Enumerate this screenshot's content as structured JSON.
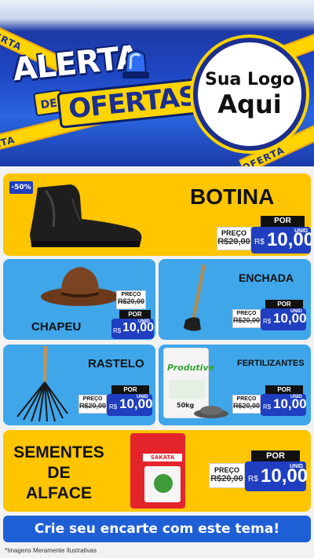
{
  "header": {
    "tape_text": "OFERTA",
    "tape_text_2": "ALERTA",
    "alerta": "ALERTA",
    "de": "DE",
    "ofertas": "OFERTAS",
    "logo_line1": "Sua Logo",
    "logo_line2": "Aqui"
  },
  "products": [
    {
      "name": "BOTINA",
      "discount": "-50%",
      "preco_label": "PREÇO",
      "old_price": "R$20,00",
      "por_label": "POR",
      "currency": "R$",
      "new_price": "10,00",
      "unit": "UNID"
    },
    {
      "name": "CHAPEU",
      "preco_label": "PREÇO",
      "old_price": "R$20,00",
      "por_label": "POR",
      "currency": "R$",
      "new_price": "10,00",
      "unit": "UNID"
    },
    {
      "name": "ENCHADA",
      "preco_label": "PREÇO",
      "old_price": "R$20,00",
      "por_label": "POR",
      "currency": "R$",
      "new_price": "10,00",
      "unit": "UNID"
    },
    {
      "name": "RASTELO",
      "preco_label": "PREÇO",
      "old_price": "R$20,00",
      "por_label": "POR",
      "currency": "R$",
      "new_price": "10,00",
      "unit": "UNID"
    },
    {
      "name": "FERTILIZANTES",
      "bag_brand": "Produtive",
      "bag_weight": "50kg",
      "preco_label": "PREÇO",
      "old_price": "R$20,00",
      "por_label": "POR",
      "currency": "R$",
      "new_price": "10,00",
      "unit": "UNID"
    },
    {
      "name_line1": "SEMENTES",
      "name_line2": "DE",
      "name_line3": "ALFACE",
      "packet_brand": "SAKATA",
      "preco_label": "PREÇO",
      "old_price": "R$20,00",
      "por_label": "POR",
      "currency": "R$",
      "new_price": "10,00",
      "unit": "UNID"
    }
  ],
  "footer": {
    "cta": "Crie seu encarte com este tema!",
    "note": "*Imagens Meramente Ilustrativas"
  },
  "colors": {
    "yellow": "#ffc500",
    "blue_card": "#3fa6ea",
    "price_blue": "#1f3ec0"
  }
}
